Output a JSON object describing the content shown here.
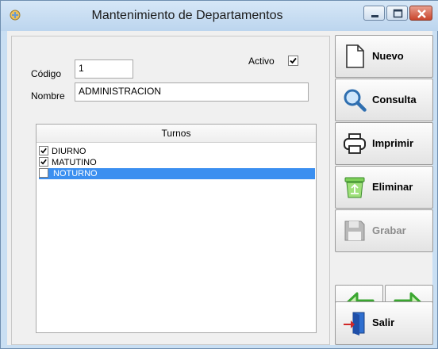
{
  "window": {
    "title": "Mantenimiento de Departamentos",
    "controls": {
      "minimize": "minimize-icon",
      "maximize": "maximize-icon",
      "close": "close-icon"
    }
  },
  "form": {
    "codigo_label": "Código",
    "codigo_value": "1",
    "nombre_label": "Nombre",
    "nombre_value": "ADMINISTRACION",
    "activo_label": "Activo",
    "activo_checked": true
  },
  "turnos": {
    "header": "Turnos",
    "items": [
      {
        "label": "DIURNO",
        "checked": true,
        "selected": false
      },
      {
        "label": "MATUTINO",
        "checked": true,
        "selected": false
      },
      {
        "label": "NOTURNO",
        "checked": false,
        "selected": true
      }
    ]
  },
  "toolbar": {
    "nuevo": "Nuevo",
    "consulta": "Consulta",
    "imprimir": "Imprimir",
    "eliminar": "Eliminar",
    "grabar": "Grabar",
    "salir": "Salir"
  },
  "colors": {
    "selection": "#3b8ff0",
    "accent_green": "#3fbf3f",
    "close_red": "#c9452c"
  }
}
